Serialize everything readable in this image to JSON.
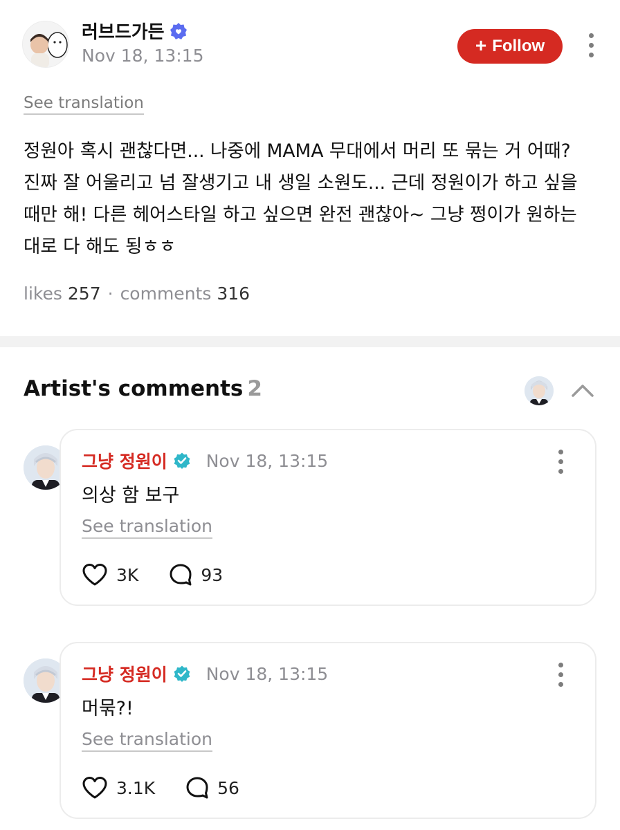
{
  "post": {
    "author": "러브드가든",
    "time": "Nov 18, 13:15",
    "follow_label": "Follow",
    "see_translation": "See translation",
    "body": "정원아 혹시 괜찮다면... 나중에 MAMA 무대에서 머리 또 묶는 거 어때? 진짜 잘 어울리고 넘 잘생기고 내 생일 소원도... 근데 정원이가 하고 싶을 때만 해! 다른 헤어스타일 하고 싶으면 완전 괜찮아~ 그냥 쩡이가 원하는 대로 다 해도 됭ㅎㅎ",
    "likes_label": "likes",
    "likes_count": "257",
    "comments_label": "comments",
    "comments_count": "316"
  },
  "artist_comments": {
    "title": "Artist's comments",
    "count": "2",
    "items": [
      {
        "author": "그냥 정원이",
        "time": "Nov 18, 13:15",
        "text": "의상 함 보구",
        "see_translation": "See translation",
        "likes": "3K",
        "replies": "93"
      },
      {
        "author": "그냥 정원이",
        "time": "Nov 18, 13:15",
        "text": "머묶?!",
        "see_translation": "See translation",
        "likes": "3.1K",
        "replies": "56"
      }
    ]
  },
  "colors": {
    "accent_red": "#d52a22",
    "verified_teal": "#2fb7c9",
    "verified_blue": "#5b6cf0",
    "muted_text": "#8e8e93"
  },
  "icons": [
    "user-avatar",
    "verified-badge-icon",
    "plus-icon",
    "more-vertical-icon",
    "chevron-up-icon",
    "heart-icon",
    "comment-bubble-icon"
  ]
}
